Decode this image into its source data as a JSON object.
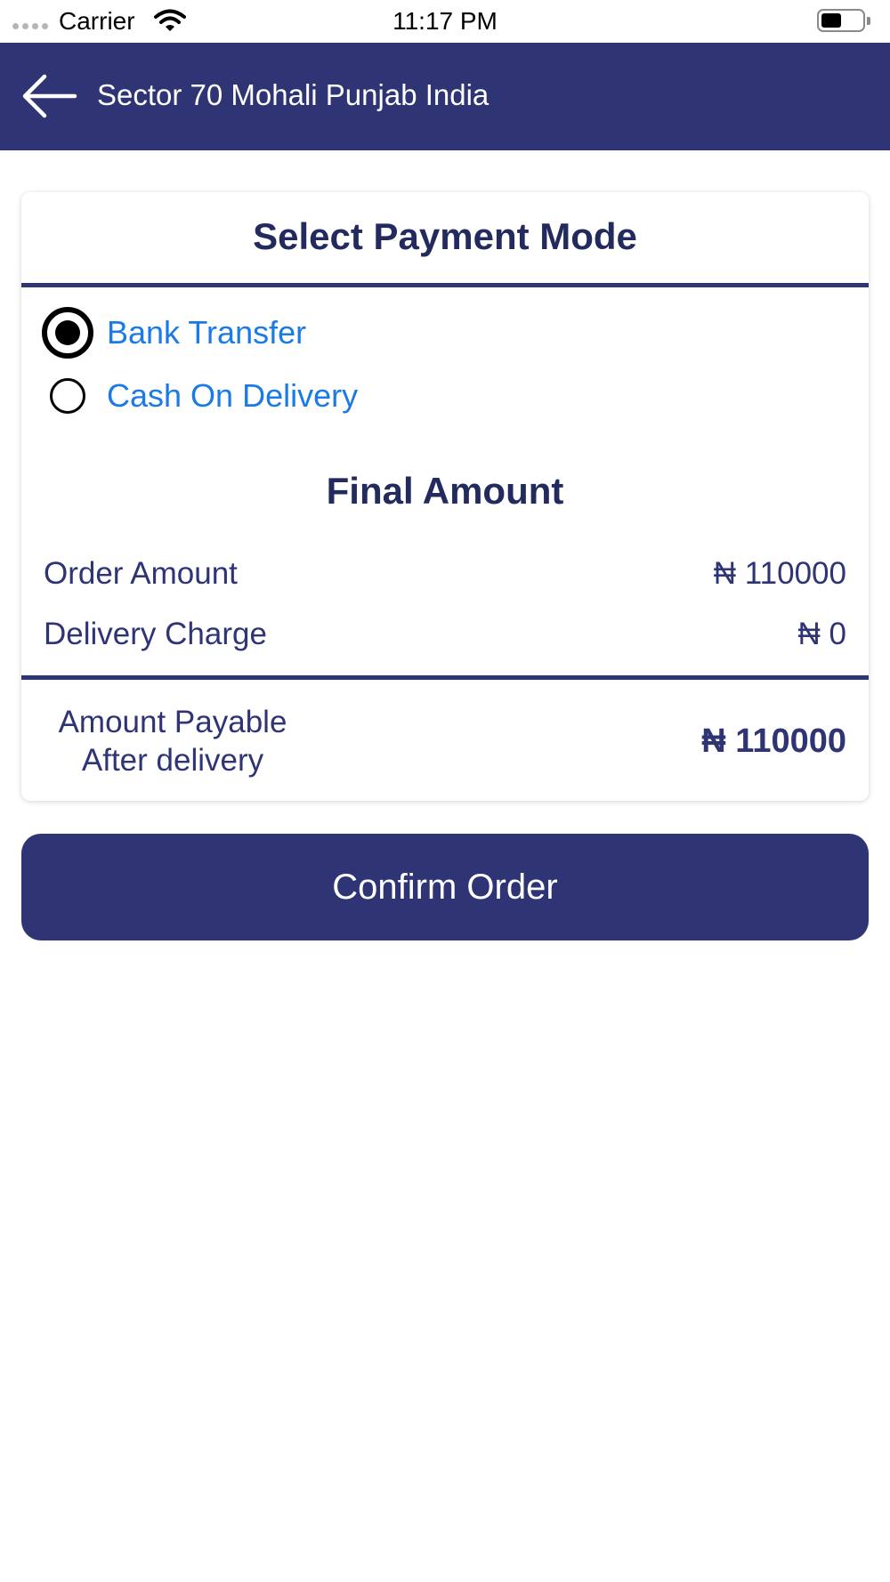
{
  "status_bar": {
    "carrier": "Carrier",
    "time": "11:17 PM",
    "icons": [
      "signal-dots-icon",
      "wifi-icon",
      "battery-icon"
    ]
  },
  "header": {
    "title": "Sector 70 Mohali Punjab India",
    "back_icon": "arrow-left-icon",
    "background_color": "#2f3475"
  },
  "payment": {
    "title": "Select Payment Mode",
    "options": [
      {
        "label": "Bank Transfer",
        "selected": true
      },
      {
        "label": "Cash On Delivery",
        "selected": false
      }
    ]
  },
  "final_amount": {
    "title": "Final Amount",
    "order_amount_label": "Order Amount",
    "order_amount_value": "₦ 110000",
    "delivery_charge_label": "Delivery Charge",
    "delivery_charge_value": "₦ 0",
    "payable_label_line1": "Amount Payable",
    "payable_label_line2": "After delivery",
    "payable_value": "₦ 110000"
  },
  "confirm_button": {
    "label": "Confirm Order"
  },
  "colors": {
    "primary": "#2f3475",
    "title_text": "#232b5e",
    "option_text": "#1a7ae6"
  }
}
